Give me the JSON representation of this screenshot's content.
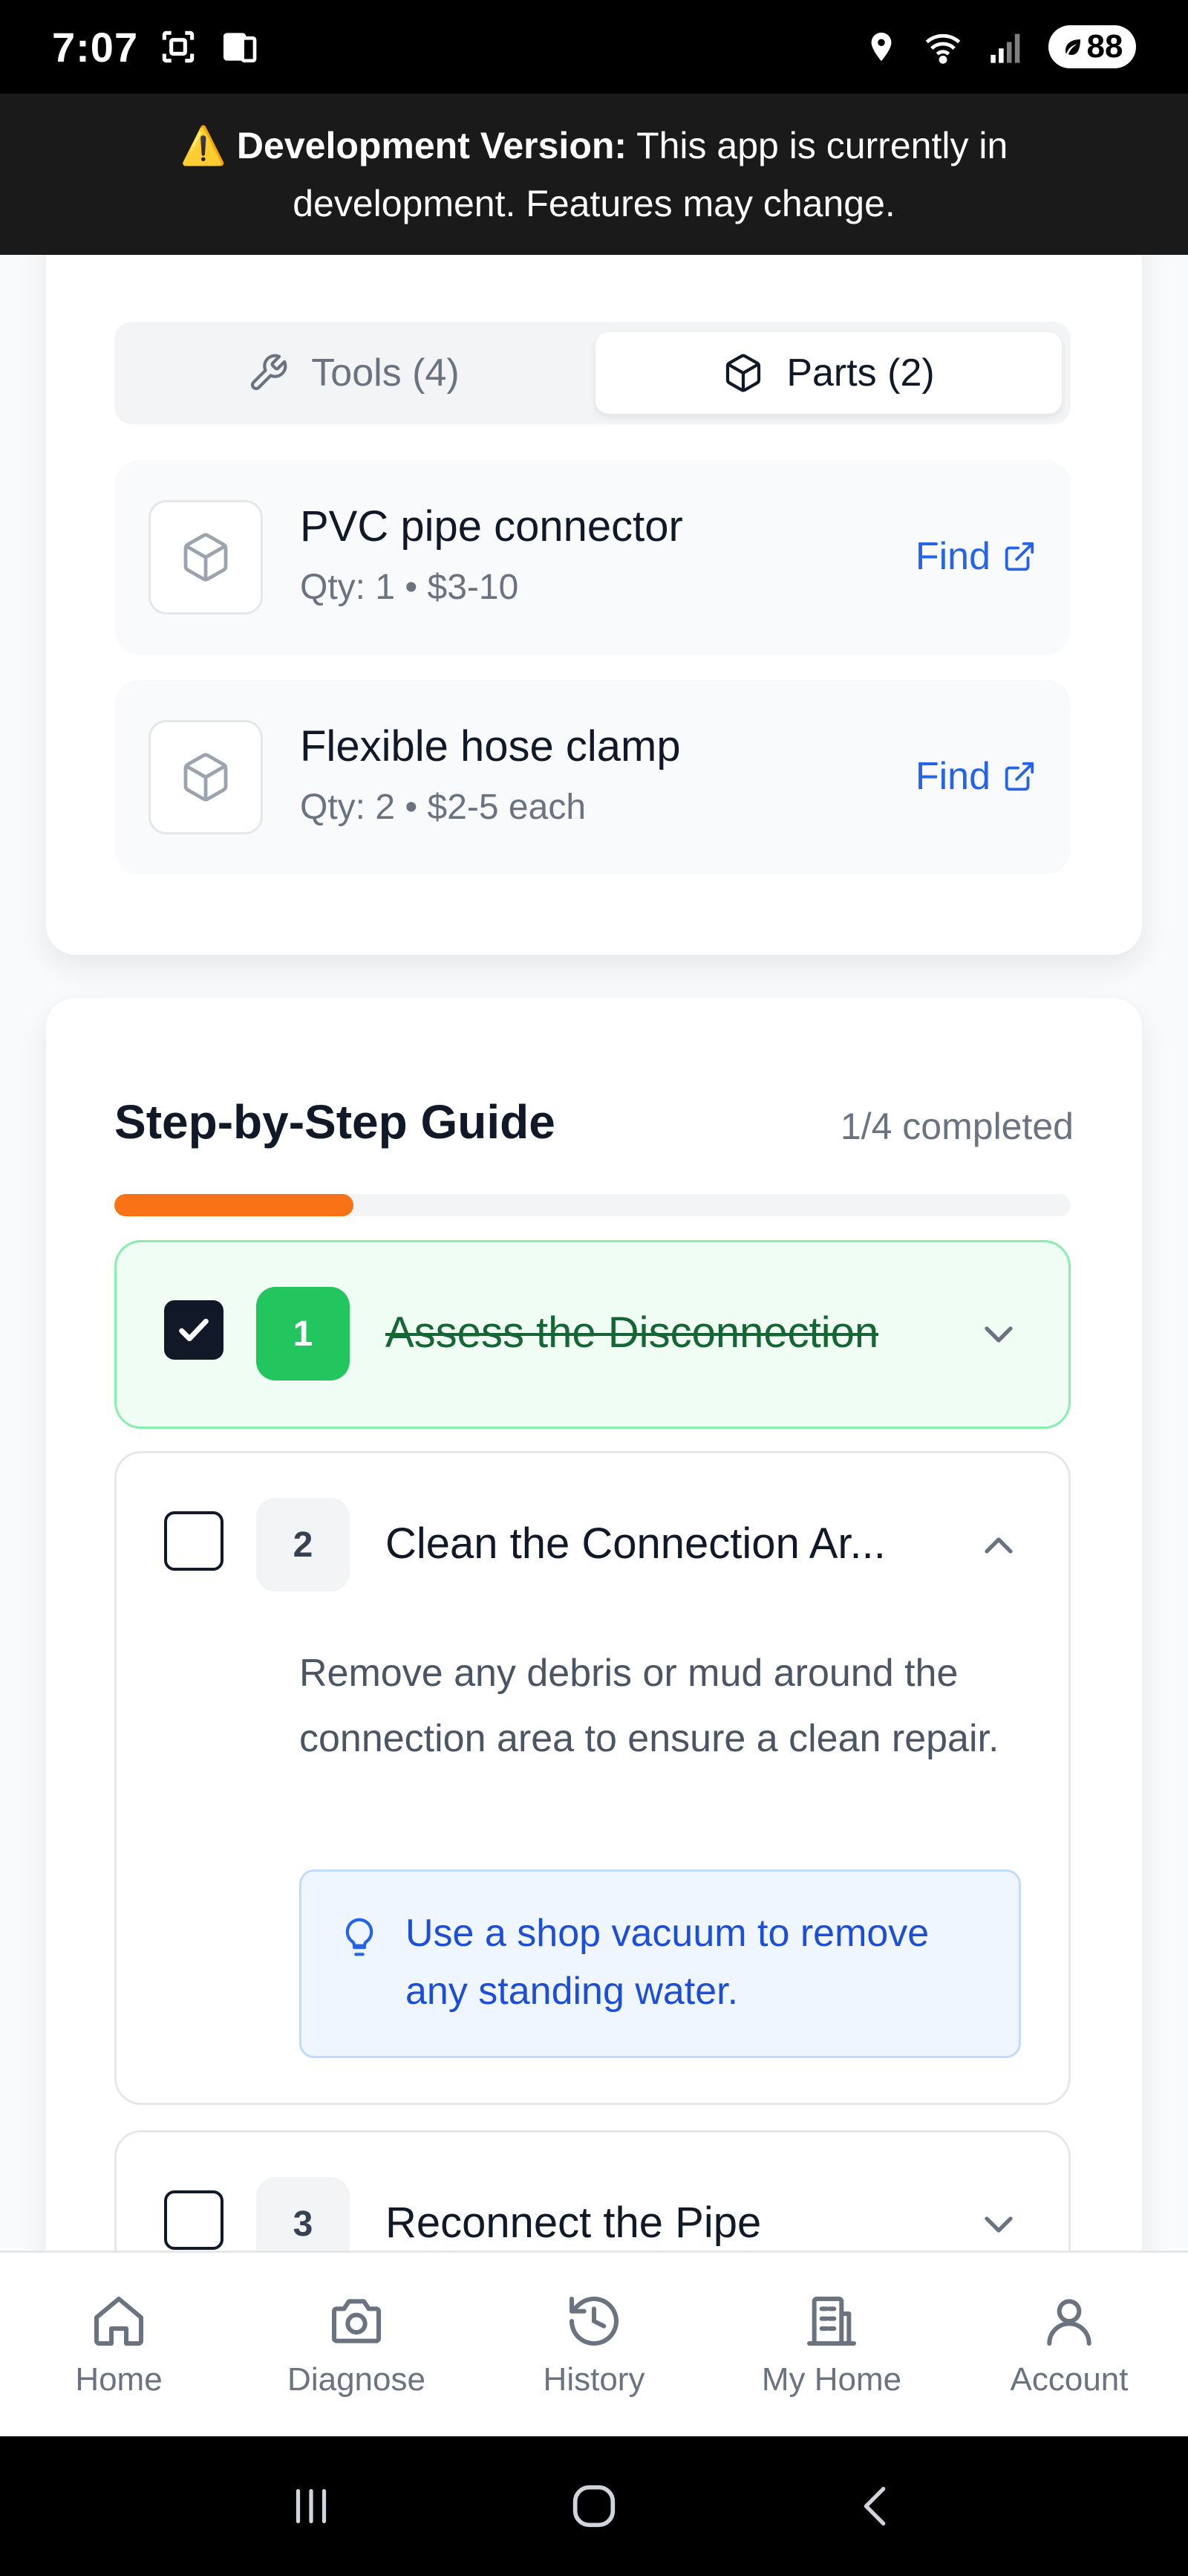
{
  "status_bar": {
    "time": "7:07",
    "battery": "88"
  },
  "dev_banner": {
    "emoji": "⚠️",
    "label": "Development Version:",
    "message": "This app is currently in development. Features may change."
  },
  "tabs": {
    "tools_label": "Tools (4)",
    "parts_label": "Parts (2)"
  },
  "parts": [
    {
      "name": "PVC pipe connector",
      "meta": "Qty: 1 • $3-10",
      "link": "Find"
    },
    {
      "name": "Flexible hose clamp",
      "meta": "Qty: 2 • $2-5 each",
      "link": "Find"
    }
  ],
  "guide": {
    "title": "Step-by-Step Guide",
    "progress_text": "1/4 completed",
    "progress_fraction": 0.25,
    "steps": [
      {
        "number": "1",
        "title": "Assess the Disconnection",
        "completed": true
      },
      {
        "number": "2",
        "title": "Clean the Connection Ar...",
        "completed": false,
        "description": "Remove any debris or mud around the connection area to ensure a clean repair.",
        "tip": "Use a shop vacuum to remove any standing water."
      },
      {
        "number": "3",
        "title": "Reconnect the Pipe",
        "completed": false
      }
    ]
  },
  "bottom_nav": {
    "home": "Home",
    "diagnose": "Diagnose",
    "history": "History",
    "my_home": "My Home",
    "account": "Account"
  },
  "colors": {
    "accent_orange": "#f97316",
    "success_green": "#22c55e",
    "link_blue": "#2563eb"
  }
}
